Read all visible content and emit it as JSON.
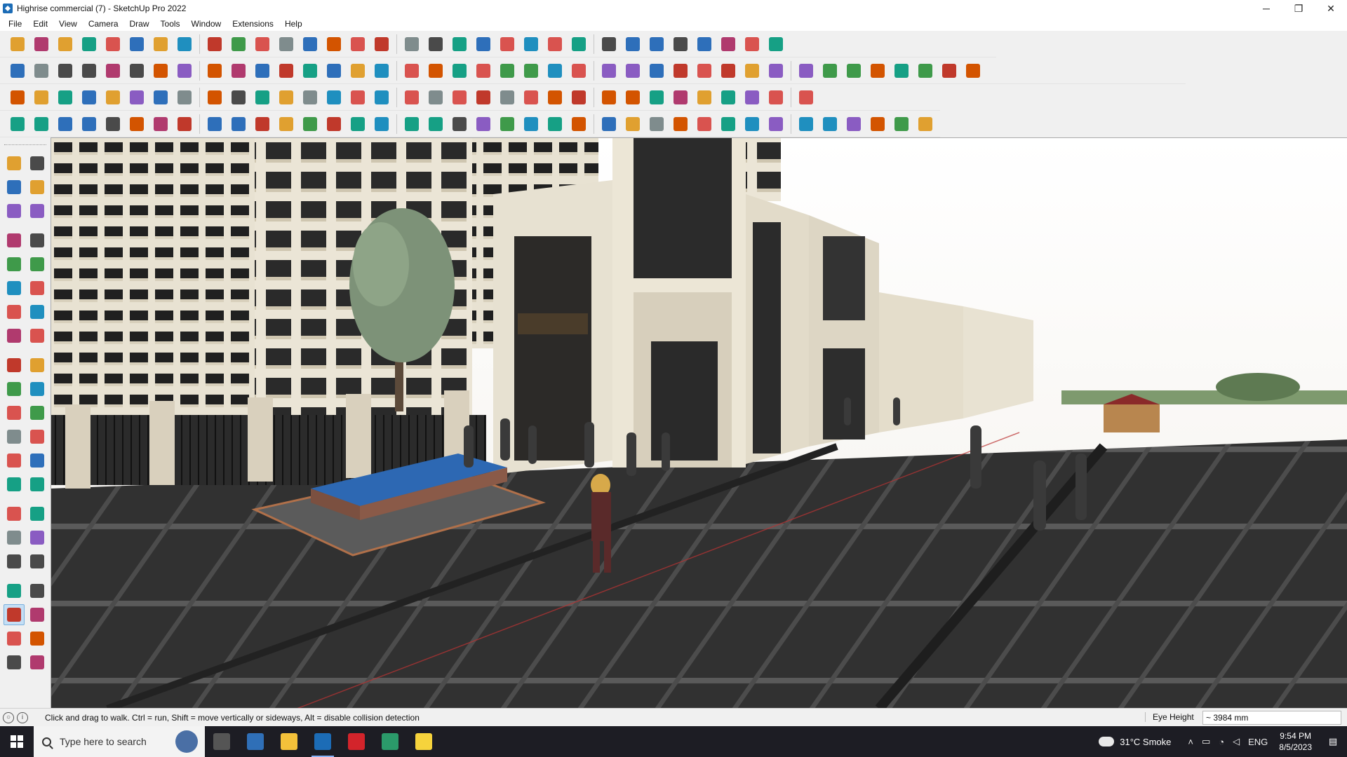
{
  "window": {
    "title": "Highrise commercial (7) - SketchUp Pro 2022",
    "controls": {
      "minimize": "─",
      "maximize": "❐",
      "close": "✕"
    }
  },
  "menubar": [
    "File",
    "Edit",
    "View",
    "Camera",
    "Draw",
    "Tools",
    "Window",
    "Extensions",
    "Help"
  ],
  "toolbars": {
    "row1": [
      "search-icon",
      "select-icon",
      "eraser-icon",
      "pencil-icon",
      "lasso-icon",
      "paint-bucket-icon",
      "push-pull-icon",
      "follow-me-icon",
      "move-icon",
      "rotate-icon",
      "scale-icon",
      "tape-measure-icon",
      "text-icon",
      "paint-icon",
      "orbit-icon",
      "walk-icon",
      "zoom-icon",
      "zoom-extents-icon",
      "camera-icon",
      "section-icon",
      "layers-icon",
      "shadow-icon",
      "styles-icon",
      "component-icon",
      "group-icon",
      "flip-icon",
      "align-icon",
      "sandbox-icon",
      "x-ray-icon",
      "undo-icon",
      "redo-icon",
      "help-icon"
    ],
    "row2": [
      "cube-icon",
      "box-icon",
      "solid-icon",
      "union-icon",
      "subtract-icon",
      "intersect-icon",
      "trim-icon",
      "split-icon",
      "outer-shell-icon",
      "hatch-icon",
      "loft-icon",
      "bend-icon",
      "extrude-icon",
      "terrain-icon",
      "house-icon",
      "roof-icon",
      "wall-icon",
      "arch-icon",
      "stair-icon",
      "column-icon",
      "curve-icon",
      "offset-icon",
      "circle-icon",
      "polygon-icon",
      "ellipse-icon",
      "star-icon",
      "spiral-icon",
      "knife-icon",
      "brush-icon",
      "cloud-icon",
      "ring-icon",
      "fillet-icon",
      "chamfer-icon",
      "material-icon",
      "texture-icon",
      "grid-icon",
      "array-icon",
      "mirror-icon",
      "explode-icon",
      "render-icon"
    ],
    "row3": [
      "cube3d-icon",
      "plane-icon",
      "face-icon",
      "edge-icon",
      "vertex-icon",
      "snap-icon",
      "copy-icon",
      "paste-icon",
      "cut-icon",
      "duplicate-icon",
      "path-icon",
      "cross-icon",
      "scissors-icon",
      "triangle-icon",
      "tree-icon",
      "warning-icon",
      "arc-icon",
      "bezier-icon",
      "node-icon",
      "target-icon",
      "bin-icon",
      "magnet-icon",
      "grid-icon",
      "block-icon",
      "assembly-icon",
      "tag-icon",
      "frame-icon",
      "pattern-icon",
      "panel-icon",
      "mesh-icon",
      "weld-icon",
      "graph-icon",
      "lattice-icon"
    ],
    "row4": [
      "line-draw-icon",
      "spline-icon",
      "chain-icon",
      "pin-icon",
      "gear-icon",
      "curve-tool-icon",
      "sweep-icon",
      "sphere-icon",
      "torus-icon",
      "wave-icon",
      "corner-icon",
      "step-icon",
      "slope-icon",
      "fold-icon",
      "archway-icon",
      "wedge-icon",
      "comb-icon",
      "fence-icon",
      "hand-icon",
      "leaf-icon",
      "fan-icon",
      "stack-icon",
      "slash-icon",
      "fork-icon",
      "broom-icon",
      "strip-icon",
      "stamp-icon",
      "slant-icon",
      "door-icon",
      "seat-icon",
      "lattice2-icon",
      "hatch2-icon",
      "bars-icon",
      "sun-icon",
      "star-shape-icon",
      "stairs-icon",
      "fan2-icon",
      "diamond-icon"
    ]
  },
  "left_tools": [
    [
      "select-arrow-icon",
      "component-rotate-icon"
    ],
    [
      "paint-bucket-icon",
      "eraser-icon"
    ],
    [
      "make-component-icon",
      "tape-icon"
    ],
    [
      "line-icon",
      "freehand-icon"
    ],
    [
      "rectangle-icon",
      "rotated-rectangle-icon"
    ],
    [
      "circle-icon",
      "polygon-icon"
    ],
    [
      "arc-icon",
      "two-point-arc-icon"
    ],
    [
      "pie-icon",
      "three-point-arc-icon"
    ],
    [
      "move-icon",
      "push-pull-icon"
    ],
    [
      "rotate-icon",
      "follow-me-icon"
    ],
    [
      "scale-icon",
      "offset-icon"
    ],
    [
      "tape-measure-icon",
      "dimension-icon"
    ],
    [
      "protractor-icon",
      "text-icon"
    ],
    [
      "axes-icon",
      "3d-text-icon"
    ],
    [
      "orbit-icon",
      "pan-icon"
    ],
    [
      "zoom-icon",
      "zoom-window-icon"
    ],
    [
      "zoom-extents-icon",
      "previous-view-icon"
    ],
    [
      "position-camera-icon",
      "look-around-icon"
    ],
    [
      "walk-icon",
      "section-plane-icon"
    ],
    [
      "section-display-icon",
      "section-cut-icon"
    ],
    [
      "section-fill-icon",
      "section-toggle-icon"
    ]
  ],
  "statusbar": {
    "hint": "Click and drag to walk.  Ctrl = run, Shift = move vertically or sideways, Alt = disable collision detection",
    "measure_label": "Eye Height",
    "measure_value": "~ 3984 mm"
  },
  "taskbar": {
    "search_placeholder": "Type here to search",
    "apps": [
      "task-view-icon",
      "calculator-icon",
      "file-explorer-icon",
      "sketchup-icon",
      "adobe-icon",
      "edge-icon",
      "sticky-notes-icon"
    ],
    "weather": "31°C  Smoke",
    "lang": "ENG",
    "time": "9:54 PM",
    "date": "8/5/2023"
  }
}
